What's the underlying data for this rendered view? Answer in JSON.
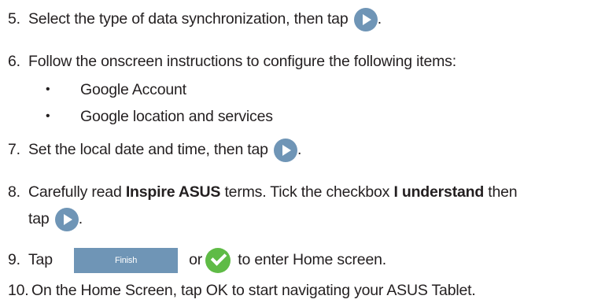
{
  "steps": [
    {
      "num": "5.",
      "text_a": "Select the type of data synchronization, then tap ",
      "text_b": "."
    },
    {
      "num": "6.",
      "text": "Follow the onscreen instructions to configure the following items:",
      "bullets": [
        "Google Account",
        "Google location and services"
      ]
    },
    {
      "num": "7.",
      "text_a": "Set the local date and time, then tap ",
      "text_b": "."
    },
    {
      "num": "8.",
      "pre": "Carefully read ",
      "bold1": "Inspire ASUS",
      "mid": " terms. Tick the checkbox ",
      "bold2": "I understand",
      "post": " then",
      "line2_a": "tap ",
      "line2_b": "."
    },
    {
      "num": "9.",
      "text_a": "Tap ",
      "button_label": "Finish",
      "or": "or",
      "text_b": " to enter Home screen."
    },
    {
      "num": "10.",
      "text": "On the Home Screen, tap OK to start navigating your ASUS Tablet."
    }
  ],
  "bullet_char": "•",
  "icons": {
    "next": "play-arrow-icon",
    "confirm": "checkmark-icon"
  },
  "colors": {
    "text": "#231f20",
    "button": "#6f95b6",
    "check": "#5fbb46"
  }
}
